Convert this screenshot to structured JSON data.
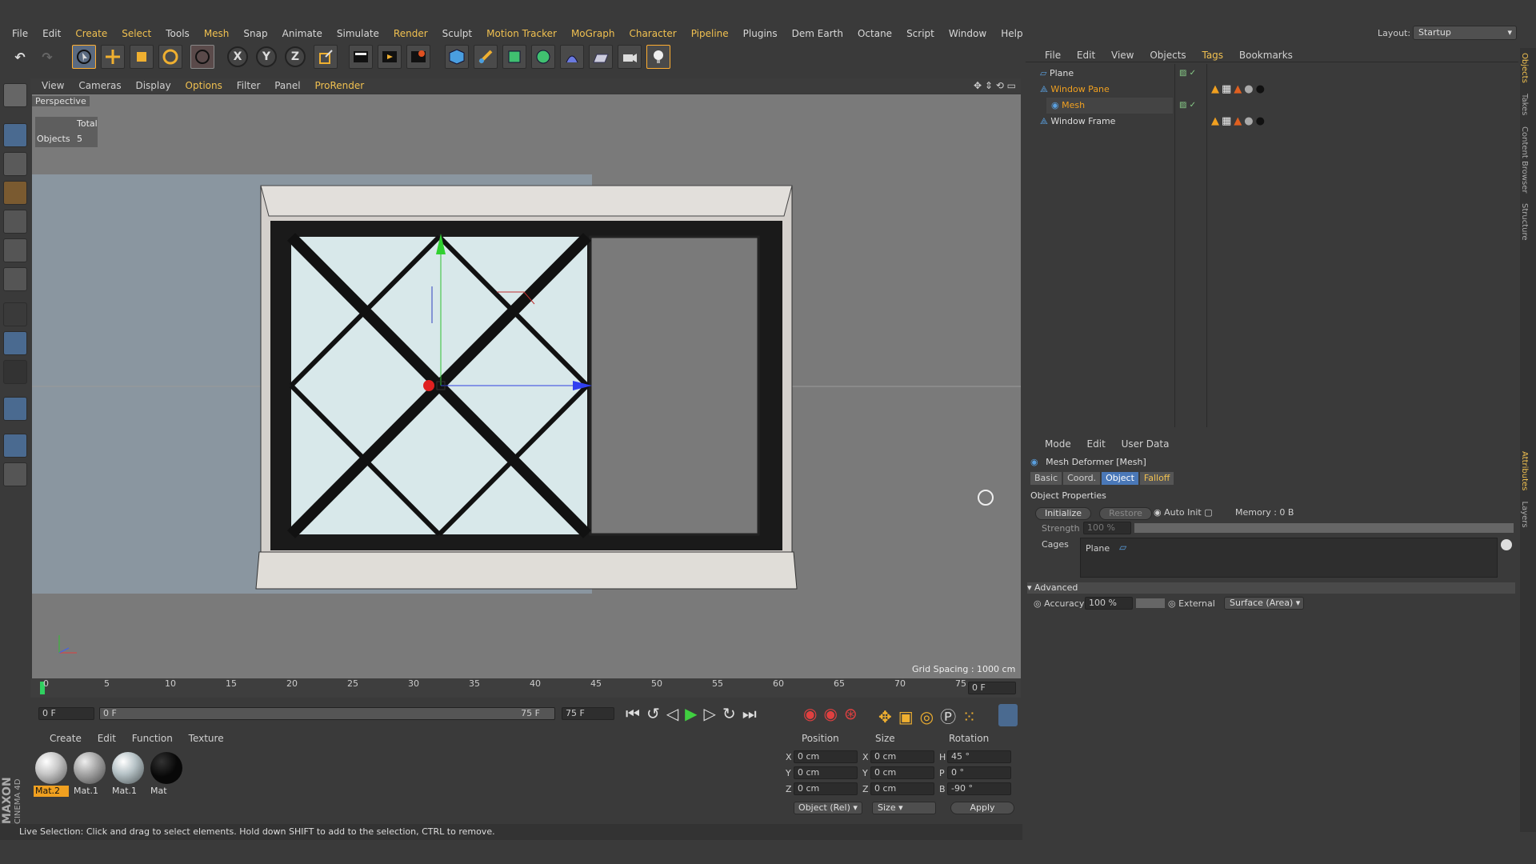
{
  "menubar": {
    "items": [
      "File",
      "Edit",
      "Create",
      "Select",
      "Tools",
      "Mesh",
      "Snap",
      "Animate",
      "Simulate",
      "Render",
      "Sculpt",
      "Motion Tracker",
      "MoGraph",
      "Character",
      "Pipeline",
      "Plugins",
      "Dem Earth",
      "Octane",
      "Script",
      "Window",
      "Help"
    ],
    "layout_label": "Layout:",
    "layout_value": "Startup"
  },
  "toolbar": {
    "x_label": "X",
    "y_label": "Y",
    "z_label": "Z"
  },
  "viewport": {
    "menu": [
      "View",
      "Cameras",
      "Display",
      "Options",
      "Filter",
      "Panel",
      "ProRender"
    ],
    "camera_label": "Perspective",
    "hud_total": "Total",
    "hud_objects_label": "Objects",
    "hud_objects_value": "5",
    "grid_spacing": "Grid Spacing : 1000 cm"
  },
  "timeline": {
    "ticks": [
      "0",
      "5",
      "10",
      "15",
      "20",
      "25",
      "30",
      "35",
      "40",
      "45",
      "50",
      "55",
      "60",
      "65",
      "70",
      "75"
    ],
    "current_frame": "0 F",
    "start_field": "0 F",
    "range_start": "0 F",
    "range_end": "75 F",
    "end_field": "75 F"
  },
  "materials": {
    "menu": [
      "Create",
      "Edit",
      "Function",
      "Texture"
    ],
    "items": [
      {
        "name": "Mat.2",
        "selected": true,
        "color": "#c8c8c8"
      },
      {
        "name": "Mat.1",
        "selected": false,
        "color": "#a8a8a8"
      },
      {
        "name": "Mat.1",
        "selected": false,
        "color": "#b8c4c8"
      },
      {
        "name": "Mat",
        "selected": false,
        "color": "#080808"
      }
    ]
  },
  "coords": {
    "headers": [
      "Position",
      "Size",
      "Rotation"
    ],
    "rows": [
      {
        "axis": "X",
        "pos": "0 cm",
        "size_axis": "X",
        "size": "0 cm",
        "rot_axis": "H",
        "rot": "45 °"
      },
      {
        "axis": "Y",
        "pos": "0 cm",
        "size_axis": "Y",
        "size": "0 cm",
        "rot_axis": "P",
        "rot": "0 °"
      },
      {
        "axis": "Z",
        "pos": "0 cm",
        "size_axis": "Z",
        "size": "0 cm",
        "rot_axis": "B",
        "rot": "-90 °"
      }
    ],
    "mode_select": "Object (Rel)",
    "size_select": "Size",
    "apply": "Apply"
  },
  "status": {
    "text": "Live Selection: Click and drag to select elements. Hold down SHIFT to add to the selection, CTRL to remove."
  },
  "objects": {
    "menu": [
      "File",
      "Edit",
      "View",
      "Objects",
      "Tags",
      "Bookmarks"
    ],
    "items": [
      {
        "name": "Plane",
        "indent": 0,
        "highlight": false
      },
      {
        "name": "Window Pane",
        "indent": 0,
        "highlight": true
      },
      {
        "name": "Mesh",
        "indent": 1,
        "highlight": true
      },
      {
        "name": "Window Frame",
        "indent": 0,
        "highlight": false
      }
    ]
  },
  "attributes": {
    "menu": [
      "Mode",
      "Edit",
      "User Data"
    ],
    "title": "Mesh Deformer [Mesh]",
    "tabs": [
      "Basic",
      "Coord.",
      "Object",
      "Falloff"
    ],
    "active_tab": "Object",
    "section": "Object Properties",
    "initialize": "Initialize",
    "restore": "Restore",
    "auto_init": "Auto Init",
    "memory": "Memory : 0 B",
    "strength_label": "Strength",
    "strength_value": "100 %",
    "cages_label": "Cages",
    "cage_item": "Plane",
    "advanced": "Advanced",
    "accuracy_label": "Accuracy",
    "accuracy_value": "100 %",
    "external_label": "External",
    "external_value": "Surface (Area)"
  },
  "side_tabs": [
    "Objects",
    "Takes",
    "Content Browser",
    "Structure",
    "Attributes",
    "Layers"
  ],
  "brand": {
    "line1": "MAXON",
    "line2": "CINEMA 4D"
  },
  "colors": {
    "accent": "#f0c050",
    "selected_tab": "#4a78b8",
    "falloff_tab": "#f0c050"
  }
}
